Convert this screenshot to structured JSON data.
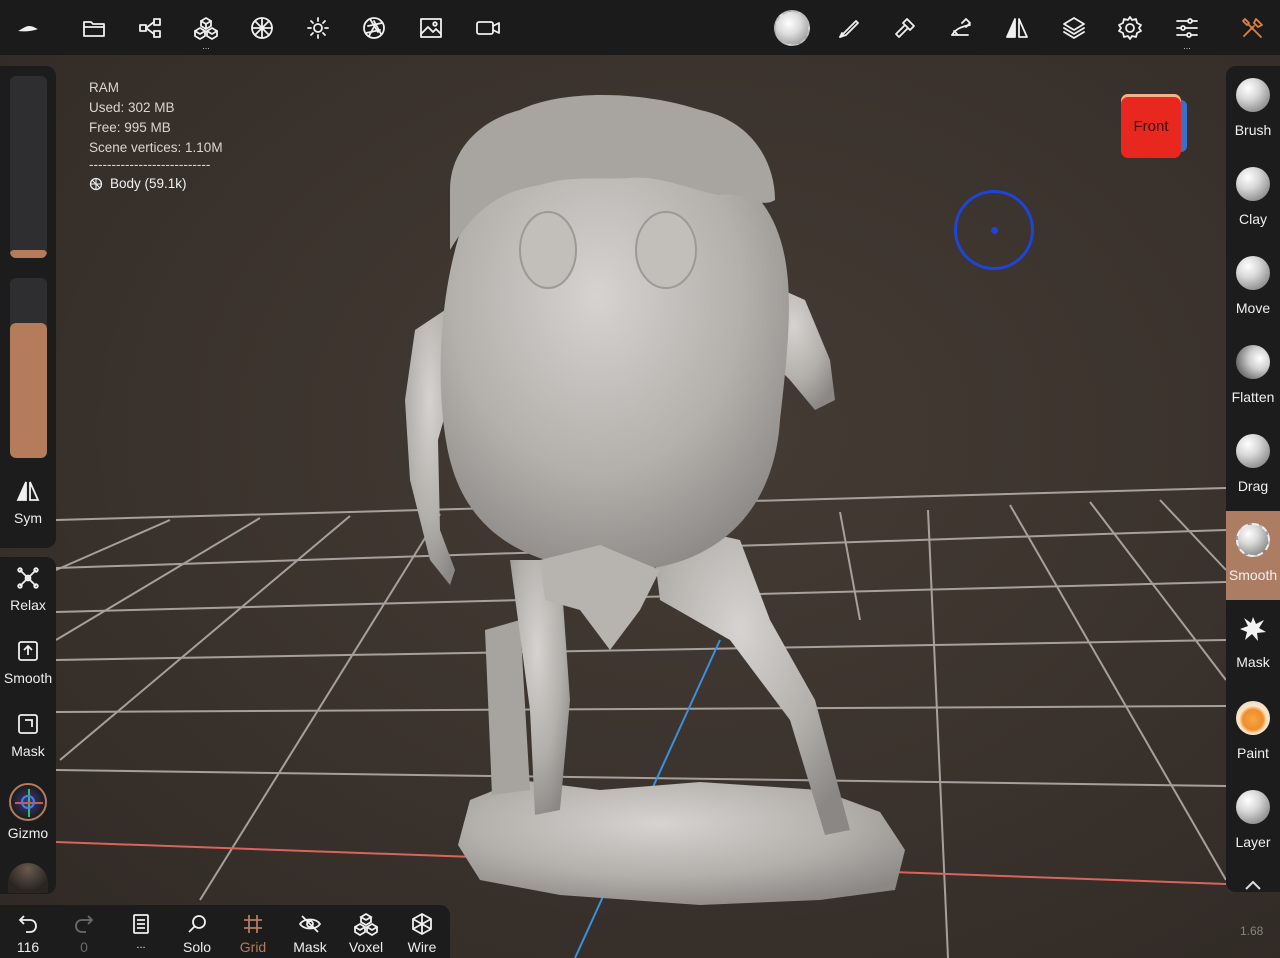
{
  "topbar": {
    "left_icons": [
      "logo-icon",
      "folder-icon",
      "share-icon",
      "scene-icon",
      "topology-icon",
      "light-icon",
      "camera-aperture-icon",
      "image-icon",
      "video-icon"
    ],
    "right_icons": [
      "brush-ball-icon",
      "stroke-icon",
      "tool-icon",
      "painting-icon",
      "symmetry-icon",
      "layers-icon",
      "settings-icon",
      "sliders-icon",
      "tools-icon"
    ],
    "accent": "#e0823f"
  },
  "stats": {
    "title": "RAM",
    "used": "Used: 302 MB",
    "free": "Free: 995 MB",
    "vertices": "Scene vertices: 1.10M",
    "separator": "---------------------------",
    "object": "Body (59.1k)"
  },
  "left": {
    "sym_label": "Sym",
    "tools": [
      {
        "label": "Relax",
        "icon": "relax-icon"
      },
      {
        "label": "Smooth",
        "icon": "smooth-box-icon"
      },
      {
        "label": "Mask",
        "icon": "mask-box-icon"
      },
      {
        "label": "Gizmo",
        "icon": "gizmo-icon"
      }
    ],
    "radius_level": 0.04,
    "intensity_level": 0.75
  },
  "right": {
    "tools": [
      {
        "label": "Brush"
      },
      {
        "label": "Clay"
      },
      {
        "label": "Move"
      },
      {
        "label": "Flatten"
      },
      {
        "label": "Drag"
      },
      {
        "label": "Smooth"
      },
      {
        "label": "Mask"
      },
      {
        "label": "Paint"
      },
      {
        "label": "Layer"
      }
    ],
    "active": "Smooth"
  },
  "bottom": {
    "undo_count": "116",
    "redo_count": "0",
    "more": "...",
    "tools": [
      "Solo",
      "Grid",
      "Mask",
      "Voxel",
      "Wire"
    ]
  },
  "navcube": {
    "label": "Front"
  },
  "version": "1.68"
}
